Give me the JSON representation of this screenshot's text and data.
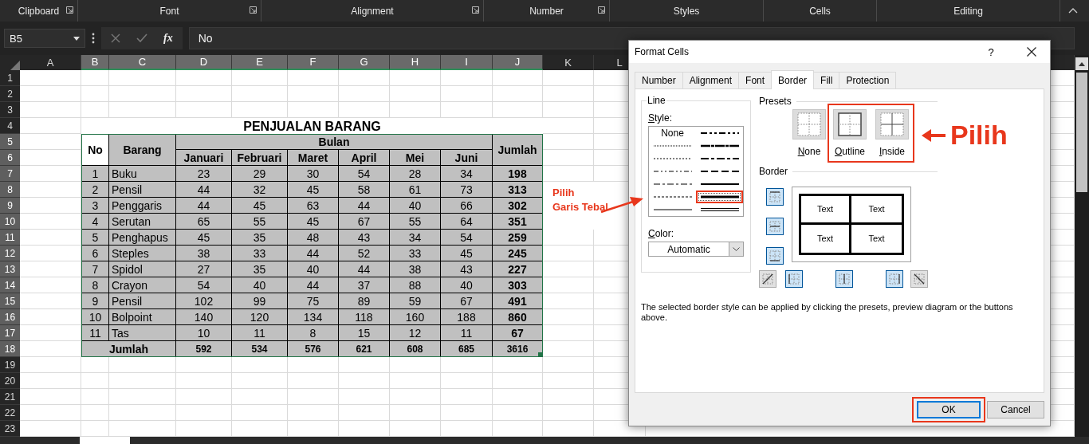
{
  "ribbon": [
    {
      "label": "Clipboard",
      "launcher": true
    },
    {
      "label": "Font",
      "launcher": true
    },
    {
      "label": "Alignment",
      "launcher": true
    },
    {
      "label": "Number",
      "launcher": true
    },
    {
      "label": "Styles",
      "launcher": false
    },
    {
      "label": "Cells",
      "launcher": false
    },
    {
      "label": "Editing",
      "launcher": false
    }
  ],
  "formula_bar": {
    "name_box": "B5",
    "function_button": "fx",
    "value": "No"
  },
  "columns": [
    {
      "label": "A",
      "selected": false
    },
    {
      "label": "B",
      "selected": true
    },
    {
      "label": "C",
      "selected": true
    },
    {
      "label": "D",
      "selected": true
    },
    {
      "label": "E",
      "selected": true
    },
    {
      "label": "F",
      "selected": true
    },
    {
      "label": "G",
      "selected": true
    },
    {
      "label": "H",
      "selected": true
    },
    {
      "label": "I",
      "selected": true
    },
    {
      "label": "J",
      "selected": true
    },
    {
      "label": "K",
      "selected": false
    },
    {
      "label": "L",
      "selected": false
    }
  ],
  "rows": [
    {
      "label": "1",
      "selected": false
    },
    {
      "label": "2",
      "selected": false
    },
    {
      "label": "3",
      "selected": false
    },
    {
      "label": "4",
      "selected": false
    },
    {
      "label": "5",
      "selected": true
    },
    {
      "label": "6",
      "selected": true
    },
    {
      "label": "7",
      "selected": true
    },
    {
      "label": "8",
      "selected": true
    },
    {
      "label": "9",
      "selected": true
    },
    {
      "label": "10",
      "selected": true
    },
    {
      "label": "11",
      "selected": true
    },
    {
      "label": "12",
      "selected": true
    },
    {
      "label": "13",
      "selected": true
    },
    {
      "label": "14",
      "selected": true
    },
    {
      "label": "15",
      "selected": true
    },
    {
      "label": "16",
      "selected": true
    },
    {
      "label": "17",
      "selected": true
    },
    {
      "label": "18",
      "selected": true
    },
    {
      "label": "19",
      "selected": false
    },
    {
      "label": "20",
      "selected": false
    },
    {
      "label": "21",
      "selected": false
    },
    {
      "label": "22",
      "selected": false
    },
    {
      "label": "23",
      "selected": false
    }
  ],
  "sheet": {
    "title": "PENJUALAN BARANG",
    "header_no": "No",
    "header_item": "Barang",
    "header_group": "Bulan",
    "months": [
      "Januari",
      "Februari",
      "Maret",
      "April",
      "Mei",
      "Juni"
    ],
    "header_total": "Jumlah",
    "rows": [
      {
        "no": "1",
        "item": "Buku",
        "values": [
          "23",
          "29",
          "30",
          "54",
          "28",
          "34"
        ],
        "total": "198"
      },
      {
        "no": "2",
        "item": "Pensil",
        "values": [
          "44",
          "32",
          "45",
          "58",
          "61",
          "73"
        ],
        "total": "313"
      },
      {
        "no": "3",
        "item": "Penggaris",
        "values": [
          "44",
          "45",
          "63",
          "44",
          "40",
          "66"
        ],
        "total": "302"
      },
      {
        "no": "4",
        "item": "Serutan",
        "values": [
          "65",
          "55",
          "45",
          "67",
          "55",
          "64"
        ],
        "total": "351"
      },
      {
        "no": "5",
        "item": "Penghapus",
        "values": [
          "45",
          "35",
          "48",
          "43",
          "34",
          "54"
        ],
        "total": "259"
      },
      {
        "no": "6",
        "item": "Steples",
        "values": [
          "38",
          "33",
          "44",
          "52",
          "33",
          "45"
        ],
        "total": "245"
      },
      {
        "no": "7",
        "item": "Spidol",
        "values": [
          "27",
          "35",
          "40",
          "44",
          "38",
          "43"
        ],
        "total": "227"
      },
      {
        "no": "8",
        "item": "Crayon",
        "values": [
          "54",
          "40",
          "44",
          "37",
          "88",
          "40"
        ],
        "total": "303"
      },
      {
        "no": "9",
        "item": "Pensil",
        "values": [
          "102",
          "99",
          "75",
          "89",
          "59",
          "67"
        ],
        "total": "491"
      },
      {
        "no": "10",
        "item": "Bolpoint",
        "values": [
          "140",
          "120",
          "134",
          "118",
          "160",
          "188"
        ],
        "total": "860"
      },
      {
        "no": "11",
        "item": "Tas",
        "values": [
          "10",
          "11",
          "8",
          "15",
          "12",
          "11"
        ],
        "total": "67"
      }
    ],
    "footer": {
      "label": "Jumlah",
      "values": [
        "592",
        "534",
        "576",
        "621",
        "608",
        "685"
      ],
      "total": "3616"
    }
  },
  "dialog": {
    "title": "Format Cells",
    "help": "?",
    "tabs": [
      {
        "label": "Number",
        "selected": false
      },
      {
        "label": "Alignment",
        "selected": false
      },
      {
        "label": "Font",
        "selected": false
      },
      {
        "label": "Border",
        "selected": true
      },
      {
        "label": "Fill",
        "selected": false
      },
      {
        "label": "Protection",
        "selected": false
      }
    ],
    "line_group": "Line",
    "style_label": "Style:",
    "line_styles": [
      {
        "kind": "none",
        "label": "None",
        "selected": false,
        "highlighted": false
      },
      {
        "kind": "hair",
        "selected": false,
        "highlighted": false
      },
      {
        "kind": "dotted",
        "selected": false,
        "highlighted": false
      },
      {
        "kind": "dash_dot_dot",
        "selected": false,
        "highlighted": false
      },
      {
        "kind": "dash_dot",
        "selected": false,
        "highlighted": false
      },
      {
        "kind": "dashed",
        "selected": false,
        "highlighted": false
      },
      {
        "kind": "thin",
        "selected": false,
        "highlighted": false
      },
      {
        "kind": "medium_dash_dot_dot",
        "selected": false,
        "highlighted": false
      },
      {
        "kind": "slant_dash_dot",
        "selected": false,
        "highlighted": false
      },
      {
        "kind": "medium_dash_dot",
        "selected": false,
        "highlighted": false
      },
      {
        "kind": "medium_dashed",
        "selected": false,
        "highlighted": false
      },
      {
        "kind": "medium",
        "selected": false,
        "highlighted": false
      },
      {
        "kind": "thick",
        "selected": true,
        "highlighted": true
      },
      {
        "kind": "double",
        "selected": false,
        "highlighted": false
      }
    ],
    "color_label": "Color:",
    "color_value": "Automatic",
    "presets_label": "Presets",
    "presets": [
      {
        "kind": "none",
        "label": "None",
        "highlighted": false
      },
      {
        "kind": "outline",
        "label": "Outline",
        "highlighted": true
      },
      {
        "kind": "inside",
        "label": "Inside",
        "highlighted": true
      }
    ],
    "border_label": "Border",
    "border_buttons": [
      {
        "kind": "top",
        "on": true
      },
      {
        "kind": "horizontal_inside",
        "on": true
      },
      {
        "kind": "bottom",
        "on": true
      },
      {
        "kind": "diagonal_up",
        "on": false
      },
      {
        "kind": "left",
        "on": true
      },
      {
        "kind": "vertical_inside",
        "on": true
      },
      {
        "kind": "right",
        "on": true
      },
      {
        "kind": "diagonal_down",
        "on": false
      }
    ],
    "preview_texts": [
      "Text",
      "Text",
      "Text",
      "Text"
    ],
    "description": "The selected border style can be applied by clicking the presets, preview diagram or the buttons above.",
    "buttons": [
      {
        "label": "OK",
        "default": true,
        "highlighted": true
      },
      {
        "label": "Cancel",
        "default": false,
        "highlighted": false
      }
    ]
  },
  "callouts": {
    "presets": "Pilih",
    "line_style": [
      "Pilih",
      "Garis Tebal"
    ]
  }
}
